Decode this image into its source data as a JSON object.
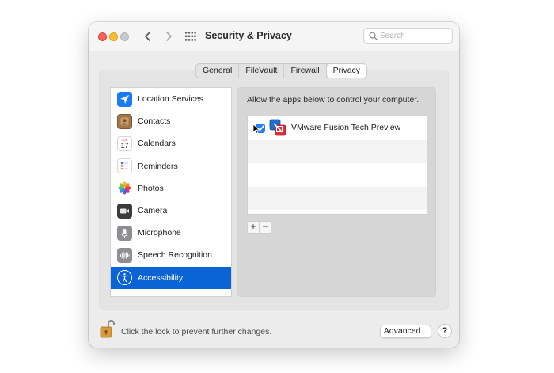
{
  "window": {
    "title": "Security & Privacy"
  },
  "search": {
    "placeholder": "Search",
    "value": ""
  },
  "tabs": [
    {
      "label": "General",
      "active": false
    },
    {
      "label": "FileVault",
      "active": false
    },
    {
      "label": "Firewall",
      "active": false
    },
    {
      "label": "Privacy",
      "active": true
    }
  ],
  "sidebar": {
    "items": [
      {
        "label": "Location Services",
        "icon": "location-arrow-icon",
        "selected": false
      },
      {
        "label": "Contacts",
        "icon": "contacts-book-icon",
        "selected": false
      },
      {
        "label": "Calendars",
        "icon": "calendar-icon",
        "selected": false,
        "icon_text_month": "JUL",
        "icon_text_day": "17"
      },
      {
        "label": "Reminders",
        "icon": "reminders-list-icon",
        "selected": false
      },
      {
        "label": "Photos",
        "icon": "photos-flower-icon",
        "selected": false
      },
      {
        "label": "Camera",
        "icon": "camera-icon",
        "selected": false
      },
      {
        "label": "Microphone",
        "icon": "microphone-icon",
        "selected": false
      },
      {
        "label": "Speech Recognition",
        "icon": "waveform-icon",
        "selected": false
      },
      {
        "label": "Accessibility",
        "icon": "accessibility-person-icon",
        "selected": true
      }
    ]
  },
  "main": {
    "instruction": "Allow the apps below to control your computer.",
    "apps": [
      {
        "name": "VMware Fusion Tech Preview",
        "checked": true,
        "icon": "vmware-fusion-icon"
      }
    ],
    "add_label": "+",
    "remove_label": "−"
  },
  "footer": {
    "lock_text": "Click the lock to prevent further changes.",
    "advanced_label": "Advanced...",
    "help_label": "?"
  },
  "colors": {
    "selection": "#0a64d6",
    "checkbox": "#2a7ef5",
    "close": "#fe5f57",
    "minimize": "#febc2e"
  }
}
